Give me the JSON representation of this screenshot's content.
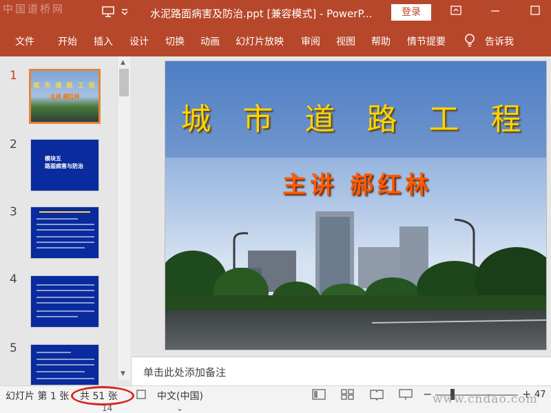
{
  "window": {
    "watermark": "中国道桥网",
    "title": "水泥路面病害及防治.ppt [兼容模式] - PowerP...",
    "login_label": "登录"
  },
  "ribbon": {
    "tabs": [
      "文件",
      "开始",
      "插入",
      "设计",
      "切换",
      "动画",
      "幻灯片放映",
      "审阅",
      "视图",
      "帮助",
      "情节提要"
    ],
    "tell_me": "告诉我"
  },
  "thumbnails": [
    {
      "num": "1",
      "title": "城 市 道 路 工 程",
      "subtitle": "主讲   郝红林"
    },
    {
      "num": "2",
      "title": "模块五",
      "subtitle": "路面病害与防治"
    },
    {
      "num": "3"
    },
    {
      "num": "4"
    },
    {
      "num": "5"
    }
  ],
  "slide": {
    "title": "城 市 道 路 工 程",
    "subtitle": "主讲  郝红林"
  },
  "notes_placeholder": "单击此处添加备注",
  "status": {
    "slide_label": "幻灯片 第 1 张",
    "total_label": "共 51 张",
    "language": "中文(中国)",
    "zoom": "47",
    "below_left": "14",
    "watermark": "www.cndao.com"
  },
  "colors": {
    "ribbon": "#b7472a",
    "slide_title": "#ffd400",
    "slide_subtitle": "#ff5a00",
    "annotation_circle": "#d7261e"
  }
}
